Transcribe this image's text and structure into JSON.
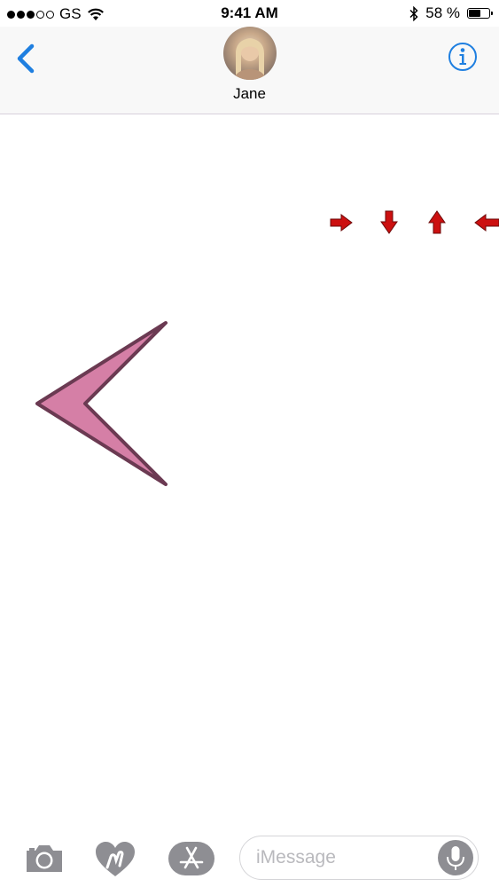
{
  "status_bar": {
    "carrier": "GS",
    "time": "9:41 AM",
    "battery_percent": "58 %",
    "battery_level": 0.58,
    "signal_full": 3,
    "signal_total": 5
  },
  "header": {
    "contact_name": "Jane",
    "icons": [
      "back-chevron-icon",
      "avatar",
      "info-icon"
    ]
  },
  "sticker_arrows": {
    "directions": [
      "right",
      "down",
      "up",
      "left"
    ],
    "color": "#cc1010"
  },
  "big_arrow": {
    "direction": "left",
    "fill": "#d57fa6",
    "stroke": "#6b3a52"
  },
  "toolbar": {
    "icons": [
      "camera-icon",
      "digital-touch-heart-icon",
      "app-store-icon",
      "microphone-icon"
    ]
  },
  "message_input": {
    "value": "",
    "placeholder": "iMessage"
  },
  "colors": {
    "accent": "#1f7fe0",
    "icon_gray": "#8e8e93"
  }
}
